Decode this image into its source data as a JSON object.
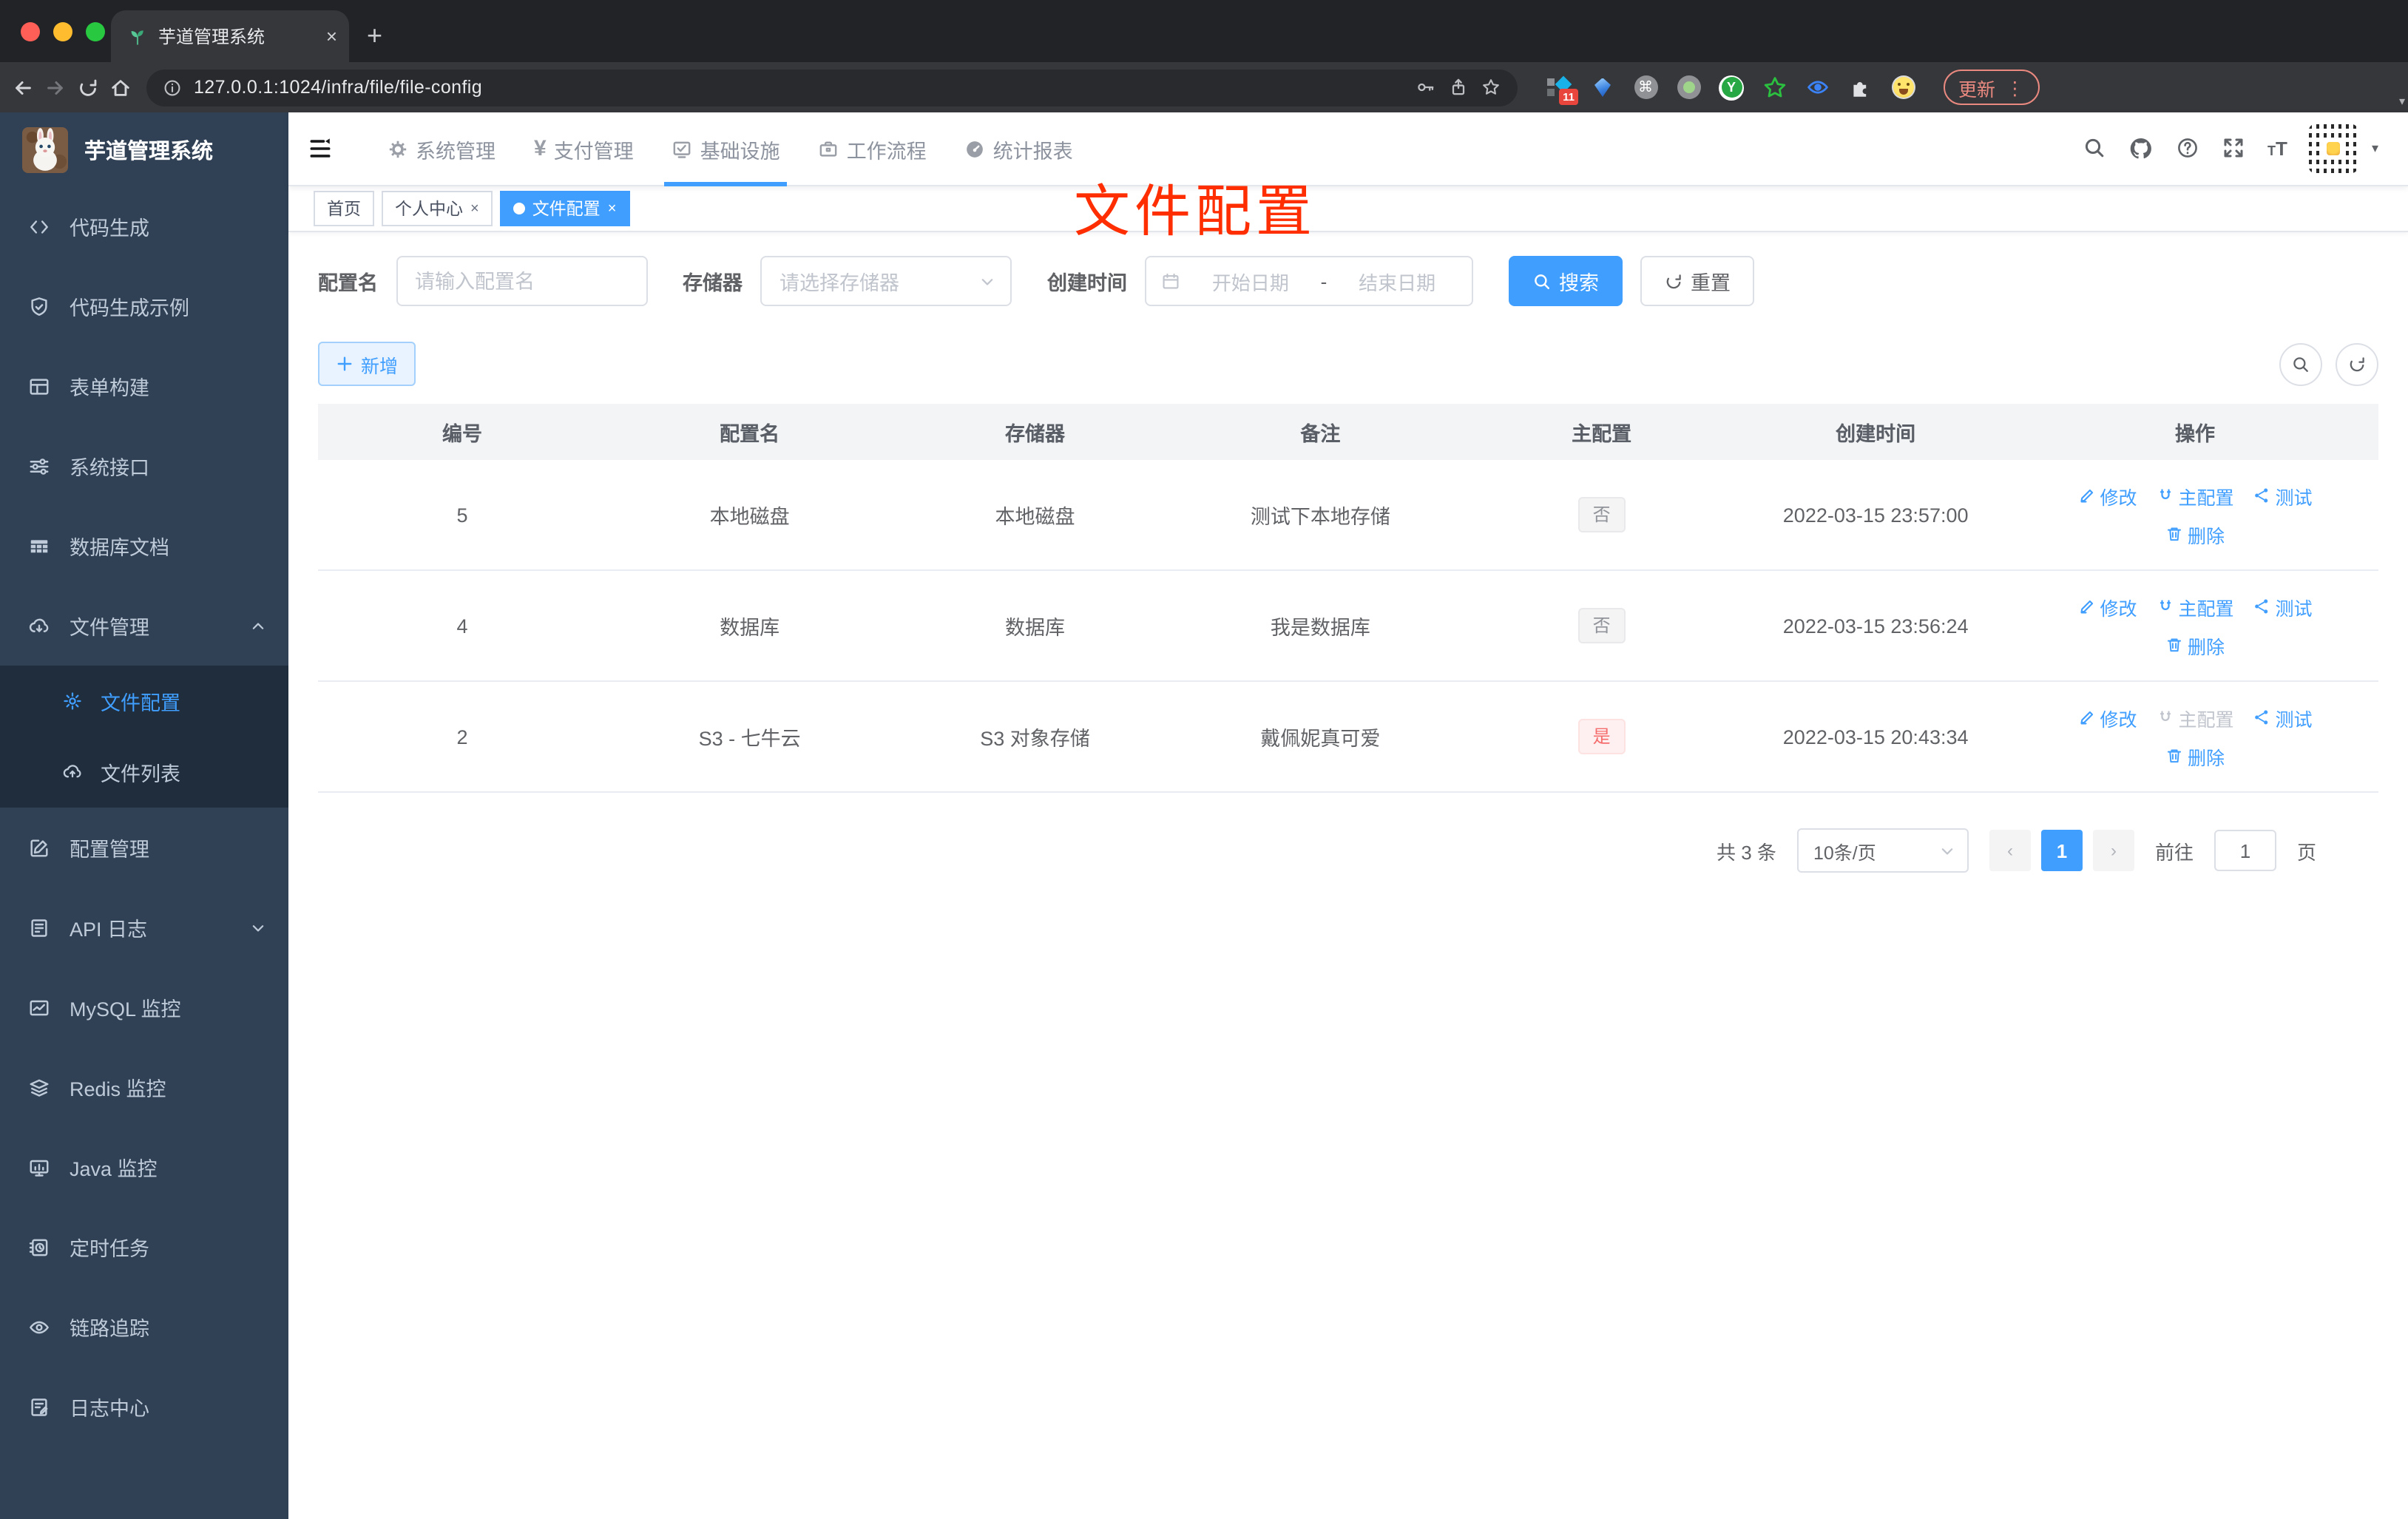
{
  "colors": {
    "accent": "#409eff",
    "danger": "#f56c6c",
    "annotation_red": "#ff2e00",
    "sidebar_bg": "#304156",
    "submenu_bg": "#1f2d3d"
  },
  "glyphs": {
    "close": "×",
    "plus": "+",
    "kebab": "⋮",
    "caret_down": "▾",
    "prev": "‹",
    "next": "›",
    "cmd": "⌘",
    "y": "Y",
    "badge": "11",
    "yen": "¥",
    "tT_small": "T",
    "tT_big": "T",
    "dash": "-"
  },
  "browser": {
    "tab": {
      "title": "芋道管理系统"
    },
    "url": "127.0.0.1:1024/infra/file/file-config",
    "update_label": "更新"
  },
  "sidebar": {
    "title": "芋道管理系统",
    "items": [
      {
        "label": "代码生成"
      },
      {
        "label": "代码生成示例"
      },
      {
        "label": "表单构建"
      },
      {
        "label": "系统接口"
      },
      {
        "label": "数据库文档"
      },
      {
        "label": "文件管理"
      },
      {
        "label": "文件配置"
      },
      {
        "label": "文件列表"
      },
      {
        "label": "配置管理"
      },
      {
        "label": "API 日志"
      },
      {
        "label": "MySQL 监控"
      },
      {
        "label": "Redis 监控"
      },
      {
        "label": "Java 监控"
      },
      {
        "label": "定时任务"
      },
      {
        "label": "链路追踪"
      },
      {
        "label": "日志中心"
      }
    ]
  },
  "topnav": {
    "items": [
      {
        "label": "系统管理"
      },
      {
        "label": "支付管理"
      },
      {
        "label": "基础设施"
      },
      {
        "label": "工作流程"
      },
      {
        "label": "统计报表"
      }
    ]
  },
  "tags": {
    "items": [
      {
        "label": "首页"
      },
      {
        "label": "个人中心"
      },
      {
        "label": "文件配置"
      }
    ]
  },
  "annotation": {
    "text": "文件配置"
  },
  "filters": {
    "name_label": "配置名",
    "name_placeholder": "请输入配置名",
    "storage_label": "存储器",
    "storage_placeholder": "请选择存储器",
    "date_label": "创建时间",
    "date_start_placeholder": "开始日期",
    "date_separator": "-",
    "date_end_placeholder": "结束日期",
    "search_label": "搜索",
    "reset_label": "重置"
  },
  "toolbar": {
    "add_label": "新增"
  },
  "table": {
    "headers": [
      "编号",
      "配置名",
      "存储器",
      "备注",
      "主配置",
      "创建时间",
      "操作"
    ],
    "rows": [
      {
        "id": "5",
        "name": "本地磁盘",
        "storage": "本地磁盘",
        "remark": "测试下本地存储",
        "master": "否",
        "created": "2022-03-15 23:57:00"
      },
      {
        "id": "4",
        "name": "数据库",
        "storage": "数据库",
        "remark": "我是数据库",
        "master": "否",
        "created": "2022-03-15 23:56:24"
      },
      {
        "id": "2",
        "name": "S3 - 七牛云",
        "storage": "S3 对象存储",
        "remark": "戴佩妮真可爱",
        "master": "是",
        "created": "2022-03-15 20:43:34"
      }
    ]
  },
  "actions": {
    "edit": "修改",
    "master": "主配置",
    "test": "测试",
    "delete": "删除"
  },
  "pagination": {
    "total_text": "共 3 条",
    "page_size": "10条/页",
    "current": "1",
    "goto_prefix": "前往",
    "goto_value": "1",
    "goto_suffix": "页"
  }
}
